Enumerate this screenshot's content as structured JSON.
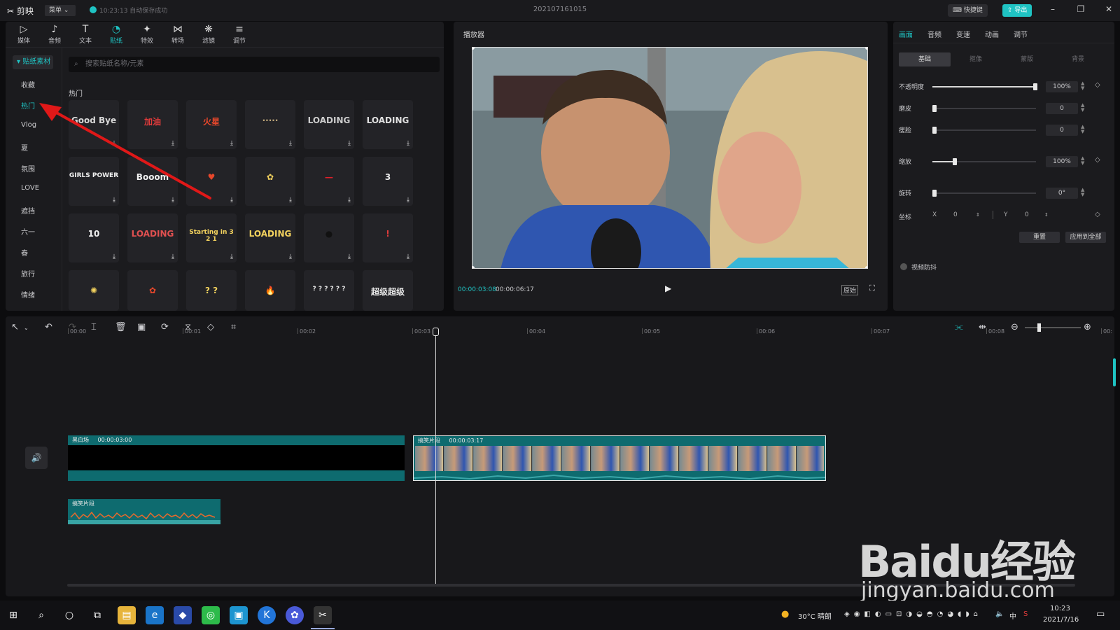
{
  "titlebar": {
    "app_name": "剪映",
    "menu_label": "菜单",
    "autosave": "10:23:13 自动保存成功",
    "project_name": "202107161015",
    "shortcut_label": "快捷键",
    "export_label": "导出",
    "min": "–",
    "max": "❐",
    "close": "✕"
  },
  "toolbar": [
    {
      "label": "媒体",
      "icon": "media-icon"
    },
    {
      "label": "音频",
      "icon": "audio-icon"
    },
    {
      "label": "文本",
      "icon": "text-icon"
    },
    {
      "label": "贴纸",
      "icon": "sticker-icon"
    },
    {
      "label": "特效",
      "icon": "effects-icon"
    },
    {
      "label": "转场",
      "icon": "transition-icon"
    },
    {
      "label": "滤镜",
      "icon": "filter-icon"
    },
    {
      "label": "调节",
      "icon": "adjust-icon"
    }
  ],
  "sticker_panel": {
    "header": "贴纸素材",
    "categories": [
      "收藏",
      "热门",
      "Vlog",
      "夏",
      "氛围",
      "LOVE",
      "遮挡",
      "六一",
      "春",
      "旅行",
      "情绪"
    ],
    "active_category": "热门",
    "search_placeholder": "搜索贴纸名称/元素",
    "section_title": "热门",
    "stickers": [
      {
        "text": "Good Bye",
        "color": "#d8d8d8"
      },
      {
        "text": "加油",
        "color": "#e23b3b"
      },
      {
        "text": "火星",
        "color": "#e8472b"
      },
      {
        "text": "·····",
        "color": "#bfa77a"
      },
      {
        "text": "LOADING",
        "color": "#cccccc"
      },
      {
        "text": "LOADING",
        "color": "#e0e0e0"
      },
      {
        "text": "GIRLS POWER",
        "color": "#f0f0f0"
      },
      {
        "text": "Booom",
        "color": "#f0f0f0"
      },
      {
        "text": "♥",
        "color": "#e8472b"
      },
      {
        "text": "✿",
        "color": "#f4d35e"
      },
      {
        "text": "—",
        "color": "#e0202a"
      },
      {
        "text": "3",
        "color": "#e8e8e8"
      },
      {
        "text": "10",
        "color": "#f0f0f0"
      },
      {
        "text": "LOADING",
        "color": "#e05050"
      },
      {
        "text": "Starting in 3 2 1",
        "color": "#f4d35e"
      },
      {
        "text": "LOADING",
        "color": "#f4d35e"
      },
      {
        "text": "●",
        "color": "#111111"
      },
      {
        "text": "!",
        "color": "#e23b3b"
      },
      {
        "text": "✺",
        "color": "#f4d35e"
      },
      {
        "text": "✿",
        "color": "#e8472b"
      },
      {
        "text": "? ?",
        "color": "#f4d35e"
      },
      {
        "text": "🔥",
        "color": "#f08a24"
      },
      {
        "text": "? ? ? ? ? ?",
        "color": "#e8e8e8"
      },
      {
        "text": "超级超级",
        "color": "#e8e8e8"
      }
    ]
  },
  "player": {
    "title": "播放器",
    "current_time": "00:00:03:08",
    "total_time": "00:00:06:17",
    "ratio_label": "原始",
    "play_icon": "play-icon"
  },
  "properties": {
    "tabs": [
      "画面",
      "音频",
      "变速",
      "动画",
      "调节"
    ],
    "active_tab": "画面",
    "subtabs": [
      "基础",
      "抠像",
      "蒙版",
      "背景"
    ],
    "active_subtab": "基础",
    "rows": [
      {
        "label": "不透明度",
        "value": "100%",
        "level": 1.0
      },
      {
        "label": "磨皮",
        "value": "0",
        "level": 0.0
      },
      {
        "label": "瘦脸",
        "value": "0",
        "level": 0.0
      },
      {
        "label": "缩放",
        "value": "100%",
        "level": 0.2
      },
      {
        "label": "旋转",
        "value": "0°",
        "level": 0.0
      }
    ],
    "position_label": "坐标",
    "x_label": "X",
    "x_value": "0",
    "y_label": "Y",
    "y_value": "0",
    "reset_label": "重置",
    "apply_all_label": "应用到全部",
    "stabilize_label": "视频防抖"
  },
  "timeline": {
    "ruler": [
      "00:00",
      "00:01",
      "00:02",
      "00:03",
      "00:04",
      "00:05",
      "00:06",
      "00:07",
      "00:08",
      "00:"
    ],
    "clips": [
      {
        "name": "黑白场",
        "duration": "00:00:03:00"
      },
      {
        "name": "搞笑片段",
        "duration": "00:00:03:17"
      }
    ],
    "audio_clip": {
      "name": "搞笑片段"
    }
  },
  "taskbar": {
    "weather": "30°C 晴朗",
    "ime": "中",
    "clock_time": "10:23",
    "clock_date": "2021/7/16"
  },
  "watermark": {
    "brand": "Baidu经验",
    "url": "jingyan.baidu.com"
  },
  "colors": {
    "accent": "#1fc3c3",
    "panel": "#1b1b1e",
    "clip": "#0f6f73",
    "annotation_arrow": "#e01818"
  }
}
